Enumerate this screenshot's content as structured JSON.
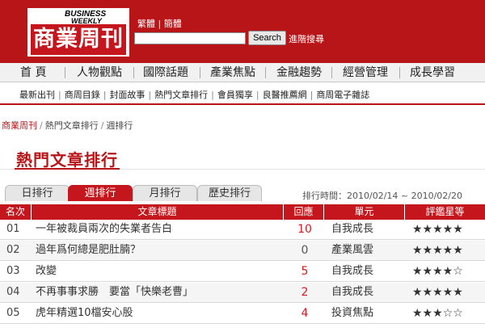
{
  "header": {
    "logo_top": "BUSINESS",
    "logo_mid": "WEEKLY",
    "logo_main": "商業周刊",
    "lang_trad": "繁體",
    "lang_sep": "|",
    "lang_simp": "簡體",
    "search_value": "",
    "search_button": "Search",
    "advanced_search": "進階搜尋"
  },
  "main_nav": [
    "首 頁",
    "人物觀點",
    "國際話題",
    "產業焦點",
    "金融趨勢",
    "經營管理",
    "成長學習"
  ],
  "sub_nav": [
    "最新出刊",
    "商周目錄",
    "封面故事",
    "熱門文章排行",
    "會員獨享",
    "良醫推薦網",
    "商周電子雜誌"
  ],
  "breadcrumb": {
    "home": "商業周刊",
    "sep": "/",
    "level2": "熱門文章排行",
    "level3": "週排行"
  },
  "page_title": "熱門文章排行",
  "tabs": [
    {
      "label": "日排行",
      "active": false
    },
    {
      "label": "週排行",
      "active": true
    },
    {
      "label": "月排行",
      "active": false
    },
    {
      "label": "歷史排行",
      "active": false
    }
  ],
  "period": "排行時間：2010/02/14 ~ 2010/02/20",
  "table": {
    "headers": {
      "rank": "名次",
      "title": "文章標題",
      "replies": "回應",
      "unit": "單元",
      "rating": "評鑑星等"
    },
    "rows": [
      {
        "rank": "01",
        "title": "一年被裁員兩次的失業者告白",
        "replies": "10",
        "unit": "自我成長",
        "stars": "★★★★★"
      },
      {
        "rank": "02",
        "title": "過年爲何總是肥肚腩？",
        "replies": "0",
        "unit": "產業風雲",
        "stars": "★★★★★"
      },
      {
        "rank": "03",
        "title": "改變",
        "replies": "5",
        "unit": "自我成長",
        "stars": "★★★★☆"
      },
      {
        "rank": "04",
        "title": "不再事事求勝　要當「快樂老曹」",
        "replies": "2",
        "unit": "自我成長",
        "stars": "★★★★★"
      },
      {
        "rank": "05",
        "title": "虎年精選10檔安心股",
        "replies": "4",
        "unit": "投資焦點",
        "stars": "★★★☆☆"
      }
    ]
  },
  "colors": {
    "brand_red": "#b81519",
    "header_red": "#c4161c"
  }
}
